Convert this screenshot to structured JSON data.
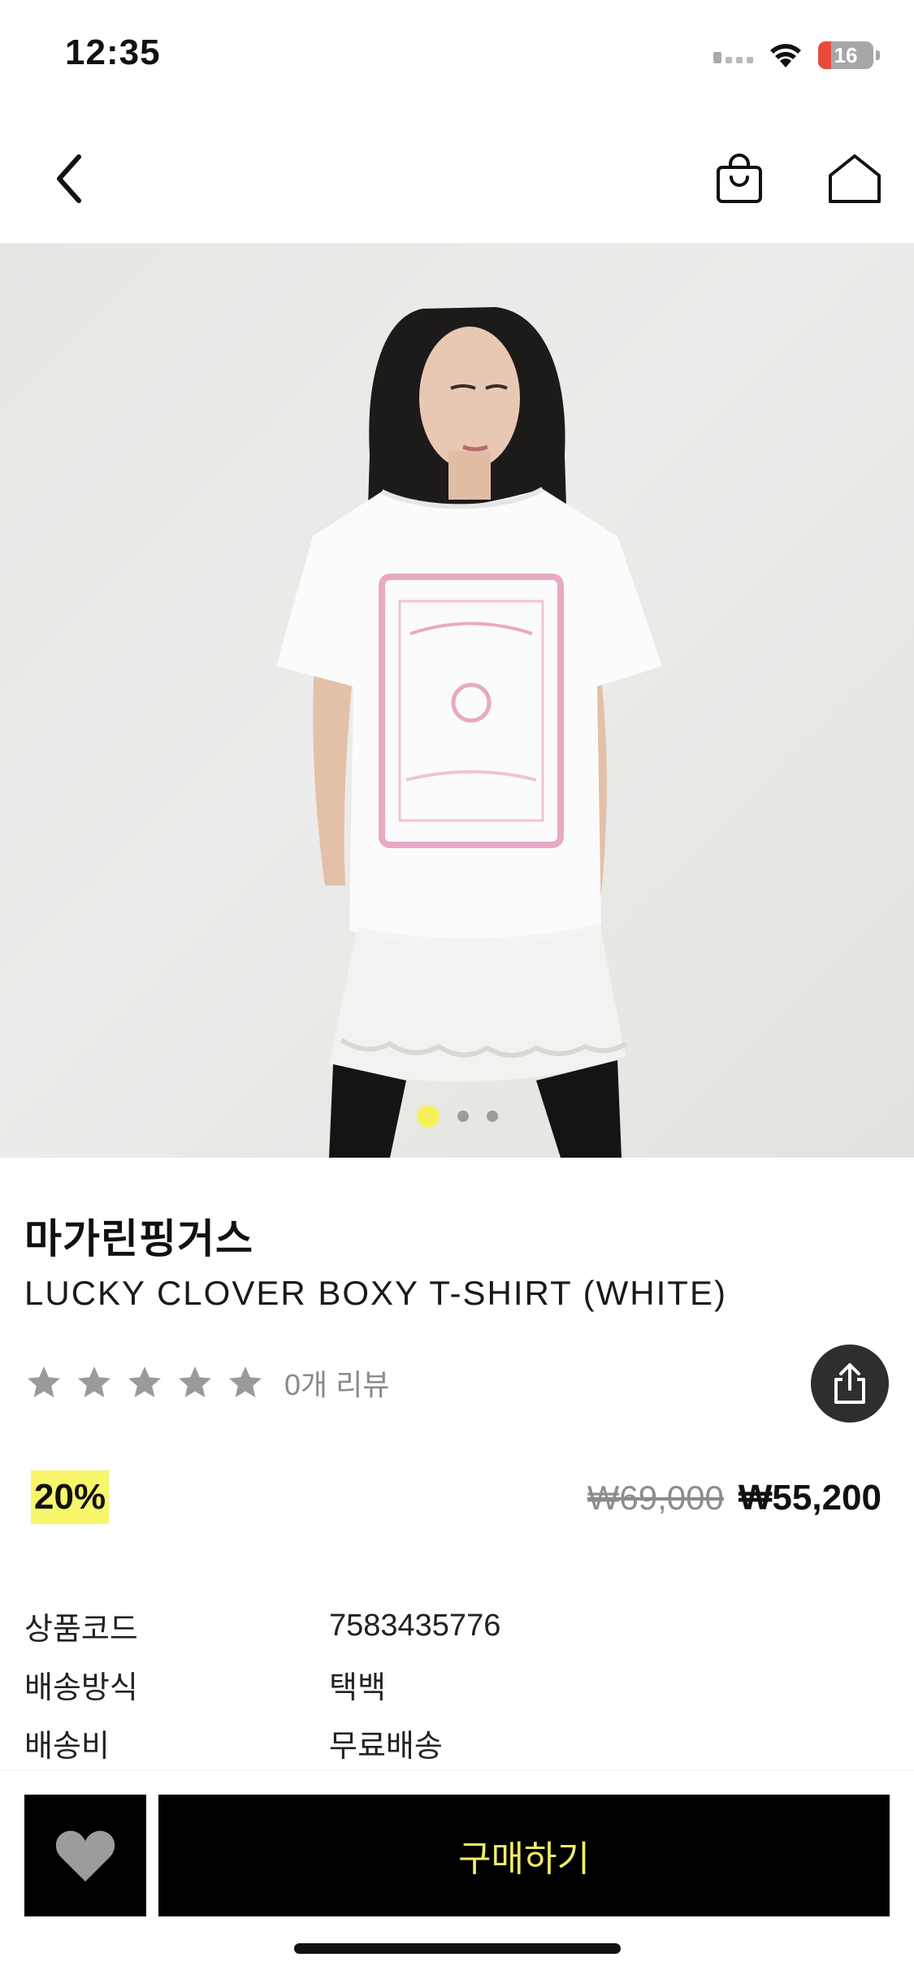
{
  "status_bar": {
    "time": "12:35",
    "battery": "16",
    "icons": [
      "cellular-signal-icon",
      "wifi-icon",
      "battery-icon"
    ]
  },
  "nav": {
    "icons": [
      "back-chevron-icon",
      "shopping-bag-icon",
      "home-icon"
    ]
  },
  "carousel": {
    "total_images": 3,
    "active_index": 0,
    "active_dot_color": "#f5f05a"
  },
  "product": {
    "brand": "마가린핑거스",
    "name": "LUCKY CLOVER BOXY T-SHIRT (WHITE)",
    "rating_stars": 5,
    "rating_value": 0,
    "review_count_label": "0개 리뷰",
    "discount_label": "20%",
    "original_price": "₩69,000",
    "sale_price": "₩55,200",
    "discount_highlight_color": "#f8f66a"
  },
  "info": [
    {
      "key": "상품코드",
      "value": "7583435776"
    },
    {
      "key": "배송방식",
      "value": "택백"
    },
    {
      "key": "배송비",
      "value": "무료배송"
    }
  ],
  "bottom_bar": {
    "buy_label": "구매하기",
    "buy_text_color": "#f3ee66"
  }
}
